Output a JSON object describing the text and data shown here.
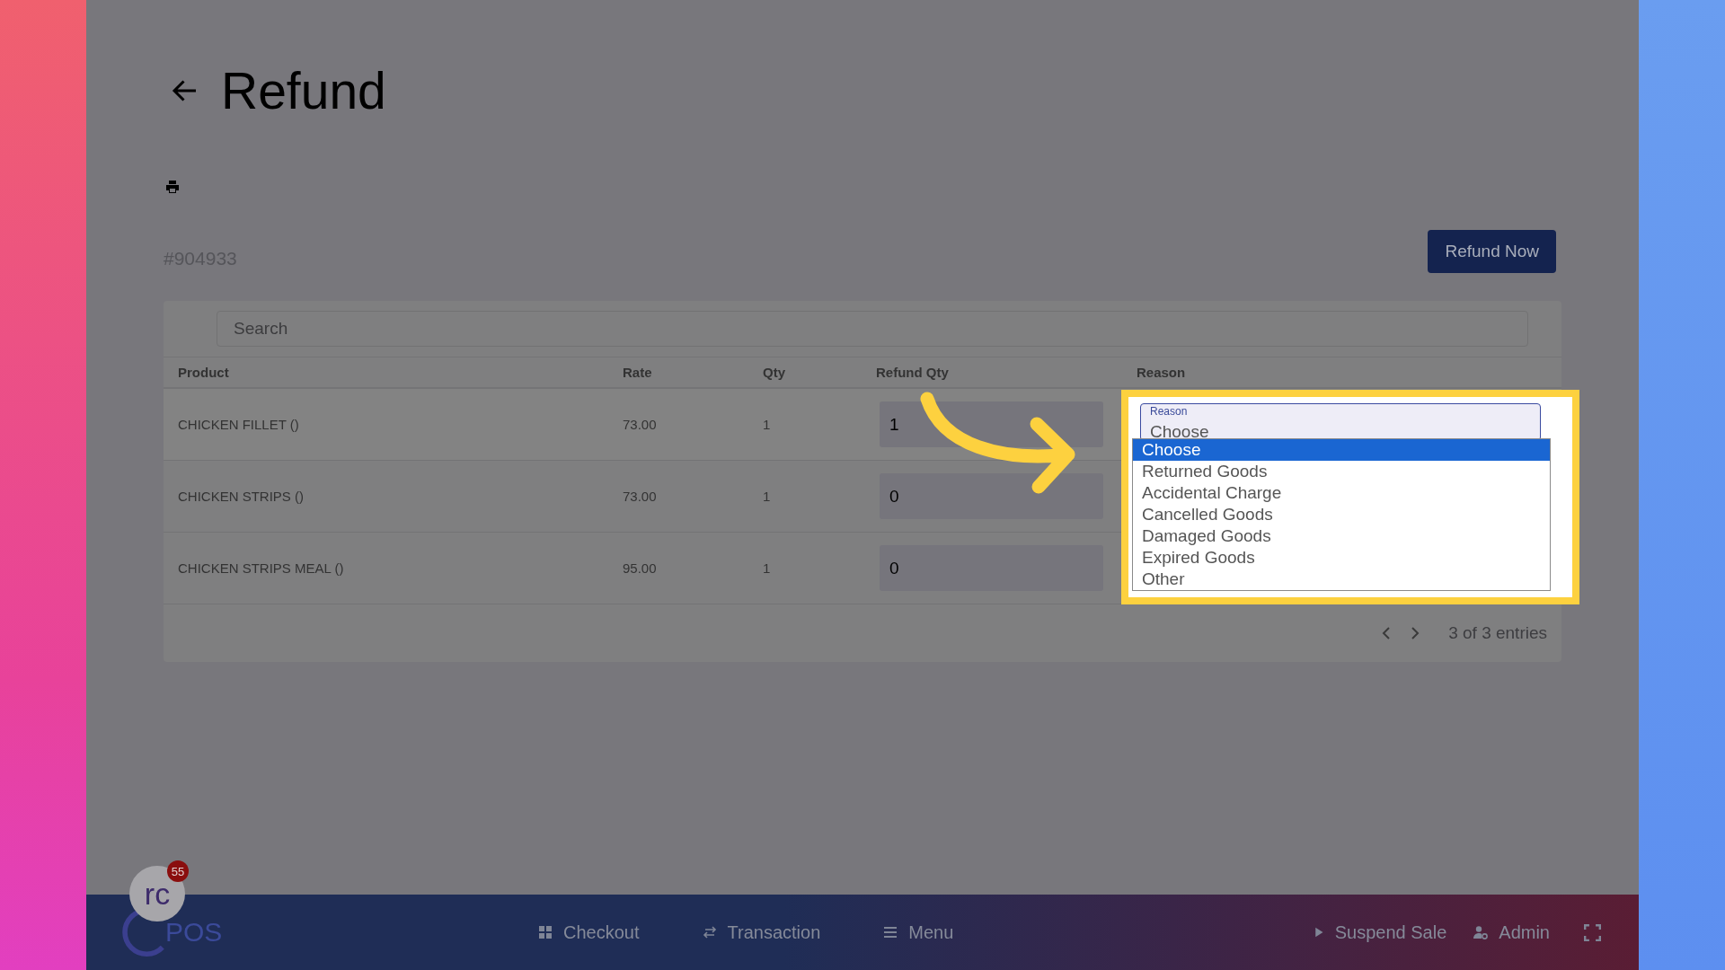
{
  "page": {
    "title": "Refund",
    "order_id": "#904933",
    "refund_button": "Refund Now"
  },
  "search": {
    "placeholder": "Search"
  },
  "table": {
    "columns": [
      "Product",
      "Rate",
      "Qty",
      "Refund Qty",
      "Reason"
    ],
    "rows": [
      {
        "product": "CHICKEN FILLET ()",
        "rate": "73.00",
        "qty": "1",
        "refund_qty": "1"
      },
      {
        "product": "CHICKEN STRIPS ()",
        "rate": "73.00",
        "qty": "1",
        "refund_qty": "0"
      },
      {
        "product": "CHICKEN STRIPS MEAL ()",
        "rate": "95.00",
        "qty": "1",
        "refund_qty": "0"
      }
    ]
  },
  "pagination": {
    "summary": "3 of 3 entries"
  },
  "reason_select": {
    "label": "Reason",
    "value": "Choose",
    "options": [
      {
        "label": "Choose",
        "selected": true
      },
      {
        "label": "Returned Goods",
        "selected": false
      },
      {
        "label": "Accidental Charge",
        "selected": false
      },
      {
        "label": "Cancelled Goods",
        "selected": false
      },
      {
        "label": "Damaged Goods",
        "selected": false
      },
      {
        "label": "Expired Goods",
        "selected": false
      },
      {
        "label": "Other",
        "selected": false
      }
    ]
  },
  "logo": {
    "mark": "rc",
    "name": "POS",
    "badge": "55"
  },
  "bottom_nav": [
    {
      "kind": "grid",
      "label": "Checkout"
    },
    {
      "kind": "swap",
      "label": "Transaction"
    },
    {
      "kind": "menu",
      "label": "Menu"
    }
  ],
  "bottom_actions": [
    {
      "kind": "play",
      "label": "Suspend Sale"
    },
    {
      "kind": "user",
      "label": "Admin"
    },
    {
      "kind": "fullscreen"
    }
  ]
}
